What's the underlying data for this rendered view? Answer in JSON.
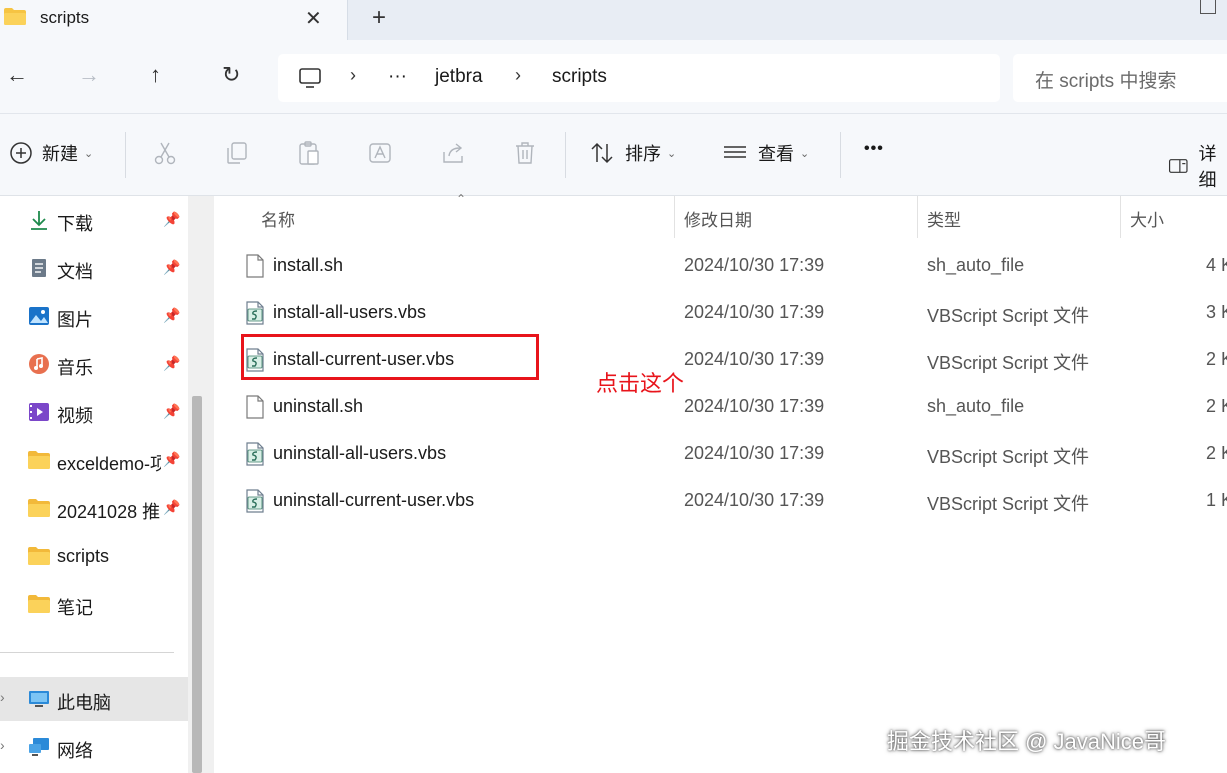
{
  "tab": {
    "title": "scripts",
    "close_glyph": "✕",
    "new_tab_glyph": "+"
  },
  "nav": {
    "back_glyph": "←",
    "forward_glyph": "→",
    "up_glyph": "↑",
    "refresh_glyph": "↻",
    "address": {
      "sep": "›",
      "ellipsis": "···",
      "crumbs": [
        "jetbra",
        "scripts"
      ]
    },
    "search_placeholder": "在 scripts 中搜索"
  },
  "toolbar": {
    "new_label": "新建",
    "sort_label": "排序",
    "view_label": "查看",
    "more_glyph": "•••",
    "details_label": "详细",
    "chevron": "⌄"
  },
  "sidebar": {
    "pin_glyph": "📌",
    "items": [
      {
        "label": "下载",
        "icon": "download-icon",
        "pinned": true
      },
      {
        "label": "文档",
        "icon": "document-icon",
        "pinned": true
      },
      {
        "label": "图片",
        "icon": "picture-icon",
        "pinned": true
      },
      {
        "label": "音乐",
        "icon": "music-icon",
        "pinned": true
      },
      {
        "label": "视频",
        "icon": "video-icon",
        "pinned": true
      },
      {
        "label": "exceldemo-项",
        "icon": "folder-icon",
        "pinned": true
      },
      {
        "label": "20241028 推",
        "icon": "folder-icon",
        "pinned": true
      },
      {
        "label": "scripts",
        "icon": "folder-icon",
        "pinned": false
      },
      {
        "label": "笔记",
        "icon": "folder-icon",
        "pinned": false
      }
    ],
    "this_pc": "此电脑",
    "network": "网络",
    "expand_glyph": "›"
  },
  "columns": {
    "name": "名称",
    "date": "修改日期",
    "type": "类型",
    "size": "大小",
    "sort_glyph": "⌃"
  },
  "files": [
    {
      "name": "install.sh",
      "date": "2024/10/30 17:39",
      "type": "sh_auto_file",
      "size": "4 K",
      "icon": "file-icon"
    },
    {
      "name": "install-all-users.vbs",
      "date": "2024/10/30 17:39",
      "type": "VBScript Script 文件",
      "size": "3 K",
      "icon": "vbs-script-icon"
    },
    {
      "name": "install-current-user.vbs",
      "date": "2024/10/30 17:39",
      "type": "VBScript Script 文件",
      "size": "2 K",
      "icon": "vbs-script-icon"
    },
    {
      "name": "uninstall.sh",
      "date": "2024/10/30 17:39",
      "type": "sh_auto_file",
      "size": "2 K",
      "icon": "file-icon"
    },
    {
      "name": "uninstall-all-users.vbs",
      "date": "2024/10/30 17:39",
      "type": "VBScript Script 文件",
      "size": "2 K",
      "icon": "vbs-script-icon"
    },
    {
      "name": "uninstall-current-user.vbs",
      "date": "2024/10/30 17:39",
      "type": "VBScript Script 文件",
      "size": "1 K",
      "icon": "vbs-script-icon"
    }
  ],
  "annotation": {
    "text": "点击这个",
    "color": "#e8141b"
  },
  "watermark": "掘金技术社区 @ JavaNice哥",
  "colors": {
    "folder": "#f6c443",
    "accent": "#0067c0",
    "highlight": "#e8141b"
  }
}
